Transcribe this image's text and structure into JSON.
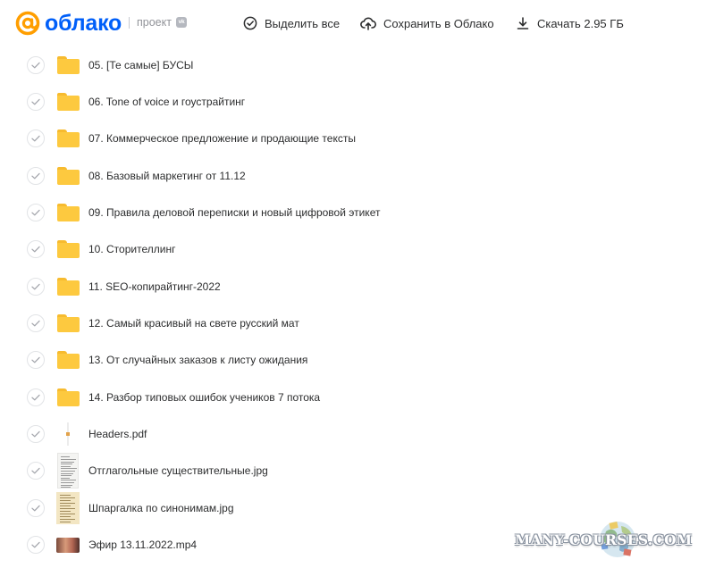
{
  "header": {
    "logo_text": "облако",
    "project_label": "проект",
    "vk_badge": "vk",
    "actions": {
      "select_all": "Выделить все",
      "save_to_cloud": "Сохранить в Облако",
      "download": "Скачать 2.95 ГБ"
    }
  },
  "colors": {
    "brand_blue": "#005ff9",
    "logo_orange": "#ff9e00",
    "folder_yellow": "#fdc93f",
    "text": "#2c2d2e",
    "muted": "#919399"
  },
  "files": [
    {
      "name": "05. [Те самые] БУСЫ",
      "type": "folder"
    },
    {
      "name": "06. Tone of voice и гоустрайтинг",
      "type": "folder"
    },
    {
      "name": "07. Коммерческое предложение и продающие тексты",
      "type": "folder"
    },
    {
      "name": "08. Базовый маркетинг от 11.12",
      "type": "folder"
    },
    {
      "name": "09. Правила деловой переписки и новый цифровой этикет",
      "type": "folder"
    },
    {
      "name": "10. Сторителлинг",
      "type": "folder"
    },
    {
      "name": "11. SEO-копирайтинг-2022",
      "type": "folder"
    },
    {
      "name": "12. Самый красивый на свете русский мат",
      "type": "folder"
    },
    {
      "name": "13. От случайных заказов к листу ожидания",
      "type": "folder"
    },
    {
      "name": "14. Разбор типовых ошибок учеников 7 потока",
      "type": "folder"
    },
    {
      "name": "Headers.pdf",
      "type": "pdf"
    },
    {
      "name": "Отглагольные существительные.jpg",
      "type": "doc-image"
    },
    {
      "name": "Шпаргалка по синонимам.jpg",
      "type": "cheat-image"
    },
    {
      "name": "Эфир 13.11.2022.mp4",
      "type": "video"
    }
  ],
  "watermark": {
    "text": "MANY-COURSES.COM"
  }
}
